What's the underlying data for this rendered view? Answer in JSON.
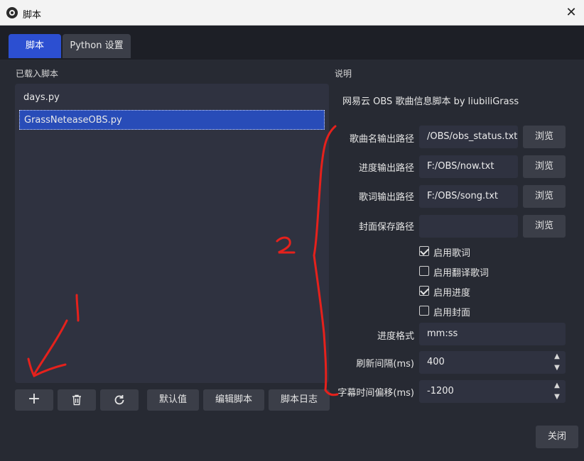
{
  "window": {
    "title": "脚本",
    "close_glyph": "✕"
  },
  "tabs": [
    {
      "label": "脚本"
    },
    {
      "label": "Python 设置"
    }
  ],
  "loaded_scripts": {
    "label": "已载入脚本",
    "items": [
      {
        "label": "days.py"
      },
      {
        "label": "GrassNeteaseOBS.py"
      }
    ]
  },
  "toolbar": {
    "add_glyph": "+",
    "defaults_label": "默认值",
    "edit_label": "编辑脚本",
    "log_label": "脚本日志"
  },
  "description": {
    "label": "说明",
    "text": "网易云 OBS 歌曲信息脚本 by liubiliGrass"
  },
  "settings": {
    "song_path": {
      "label": "歌曲名输出路径",
      "value": "/OBS/obs_status.txt"
    },
    "progress_path": {
      "label": "进度输出路径",
      "value": "F:/OBS/now.txt"
    },
    "lyric_path": {
      "label": "歌词输出路径",
      "value": "F:/OBS/song.txt"
    },
    "cover_path": {
      "label": "封面保存路径",
      "value": ""
    },
    "browse_label": "浏览",
    "checks": [
      {
        "label": "启用歌词",
        "checked": true
      },
      {
        "label": "启用翻译歌词",
        "checked": false
      },
      {
        "label": "启用进度",
        "checked": true
      },
      {
        "label": "启用封面",
        "checked": false
      }
    ],
    "progress_format": {
      "label": "进度格式",
      "value": "mm:ss"
    },
    "refresh_interval": {
      "label": "刷新间隔(ms)",
      "value": "400"
    },
    "subtitle_offset": {
      "label": "字幕时间偏移(ms)",
      "value": "-1200"
    },
    "spin_up": "▲",
    "spin_down": "▼"
  },
  "close_label": "关闭",
  "annotations": {
    "one": "1",
    "two": "2",
    "color": "#e5211c"
  }
}
